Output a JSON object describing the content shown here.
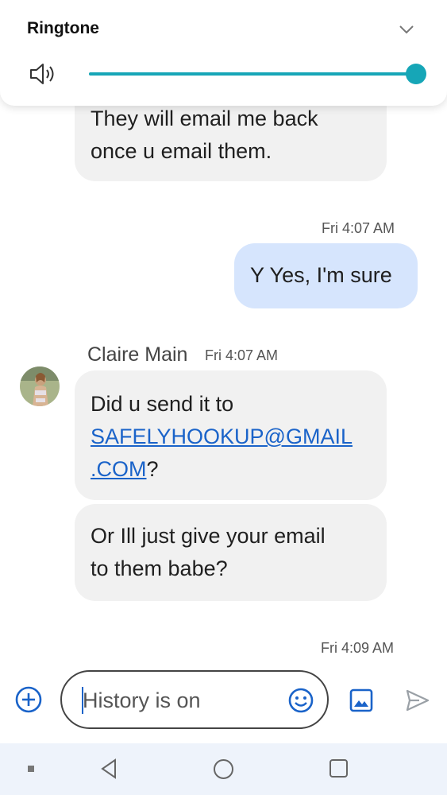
{
  "volume_panel": {
    "title": "Ringtone",
    "level": 1.0,
    "accent_color": "#16a6b7",
    "icons": [
      "speaker-icon",
      "chevron-down-icon"
    ]
  },
  "conversation": {
    "partial_message": {
      "lines": [
        "They will email me back",
        "once u email them."
      ]
    },
    "outgoing_timestamp": "Fri 4:07 AM",
    "outgoing_message": "Y Yes, I'm sure",
    "sender_name": "Claire Main",
    "sender_timestamp": "Fri 4:07 AM",
    "incoming_1": {
      "line1": "Did u send it to",
      "link_part1": "SAFELYHOOKUP@GMAIL",
      "link_part2": ".COM",
      "suffix": "?"
    },
    "incoming_2": {
      "lines": [
        "Or Ill just give your email",
        "to them babe?"
      ]
    },
    "last_timestamp": "Fri 4:09 AM"
  },
  "compose": {
    "placeholder": "History is on",
    "icons": [
      "add-icon",
      "emoji-icon",
      "gallery-icon",
      "send-icon"
    ]
  },
  "nav_bar": {
    "icons": [
      "recents-square-small-icon",
      "back-icon",
      "home-icon",
      "overview-icon"
    ]
  }
}
